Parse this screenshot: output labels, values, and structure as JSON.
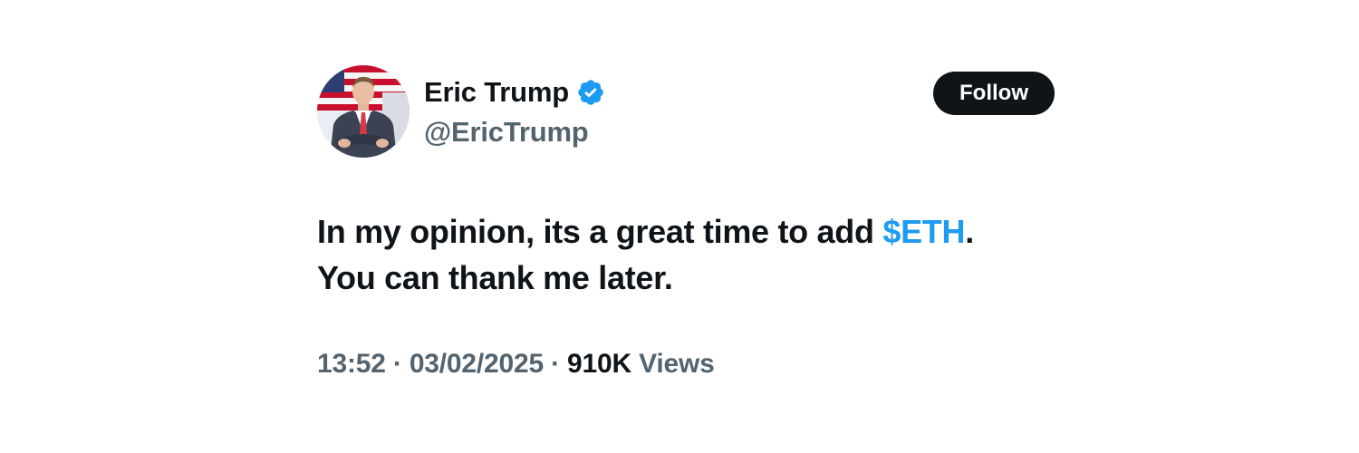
{
  "author": {
    "display_name": "Eric Trump",
    "handle": "@EricTrump",
    "verified_icon": "verified-check-icon",
    "avatar": "profile-photo"
  },
  "follow_button": {
    "label": "Follow"
  },
  "tweet": {
    "text_before": "In my opinion, its a great time to add ",
    "cashtag": "$ETH",
    "text_after": ".",
    "line2": "You can thank me later."
  },
  "meta": {
    "time": "13:52",
    "separator": "·",
    "date": "03/02/2025",
    "views_count": "910K",
    "views_label": "Views"
  },
  "colors": {
    "text_primary": "#0f1419",
    "text_secondary": "#536471",
    "accent": "#1d9bf0",
    "button_bg": "#0f1419",
    "button_text": "#ffffff"
  }
}
